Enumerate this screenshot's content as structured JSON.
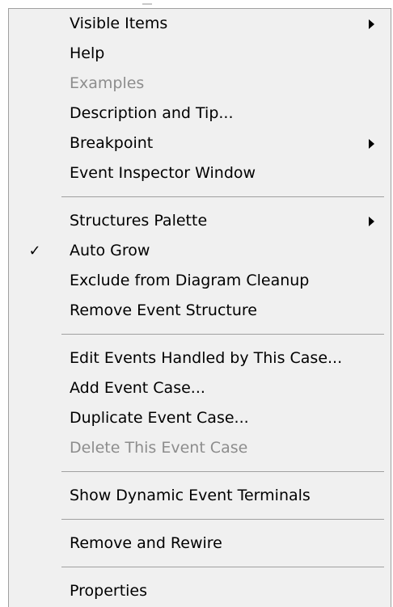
{
  "menu": {
    "group1": [
      {
        "label": "Visible Items",
        "submenu": true,
        "disabled": false
      },
      {
        "label": "Help",
        "submenu": false,
        "disabled": false
      },
      {
        "label": "Examples",
        "submenu": false,
        "disabled": true
      },
      {
        "label": "Description and Tip...",
        "submenu": false,
        "disabled": false
      },
      {
        "label": "Breakpoint",
        "submenu": true,
        "disabled": false
      },
      {
        "label": "Event Inspector Window",
        "submenu": false,
        "disabled": false
      }
    ],
    "group2": [
      {
        "label": "Structures Palette",
        "submenu": true,
        "disabled": false
      },
      {
        "label": "Auto Grow",
        "checked": true,
        "check_glyph": "✓",
        "disabled": false
      },
      {
        "label": "Exclude from Diagram Cleanup",
        "disabled": false
      },
      {
        "label": "Remove Event Structure",
        "disabled": false
      }
    ],
    "group3": [
      {
        "label": "Edit Events Handled by This Case...",
        "disabled": false
      },
      {
        "label": "Add Event Case...",
        "disabled": false
      },
      {
        "label": "Duplicate Event Case...",
        "disabled": false
      },
      {
        "label": "Delete This Event Case",
        "disabled": true
      }
    ],
    "group4": [
      {
        "label": "Show Dynamic Event Terminals",
        "disabled": false
      }
    ],
    "group5": [
      {
        "label": "Remove and Rewire",
        "disabled": false
      }
    ],
    "group6": [
      {
        "label": "Properties",
        "disabled": false
      }
    ]
  },
  "colors": {
    "menu_bg": "#f0f0f0",
    "disabled_text": "#8d8d8d",
    "separator": "#a0a0a0"
  },
  "icons": {
    "submenu": "triangle-right-icon",
    "check": "check-icon"
  }
}
